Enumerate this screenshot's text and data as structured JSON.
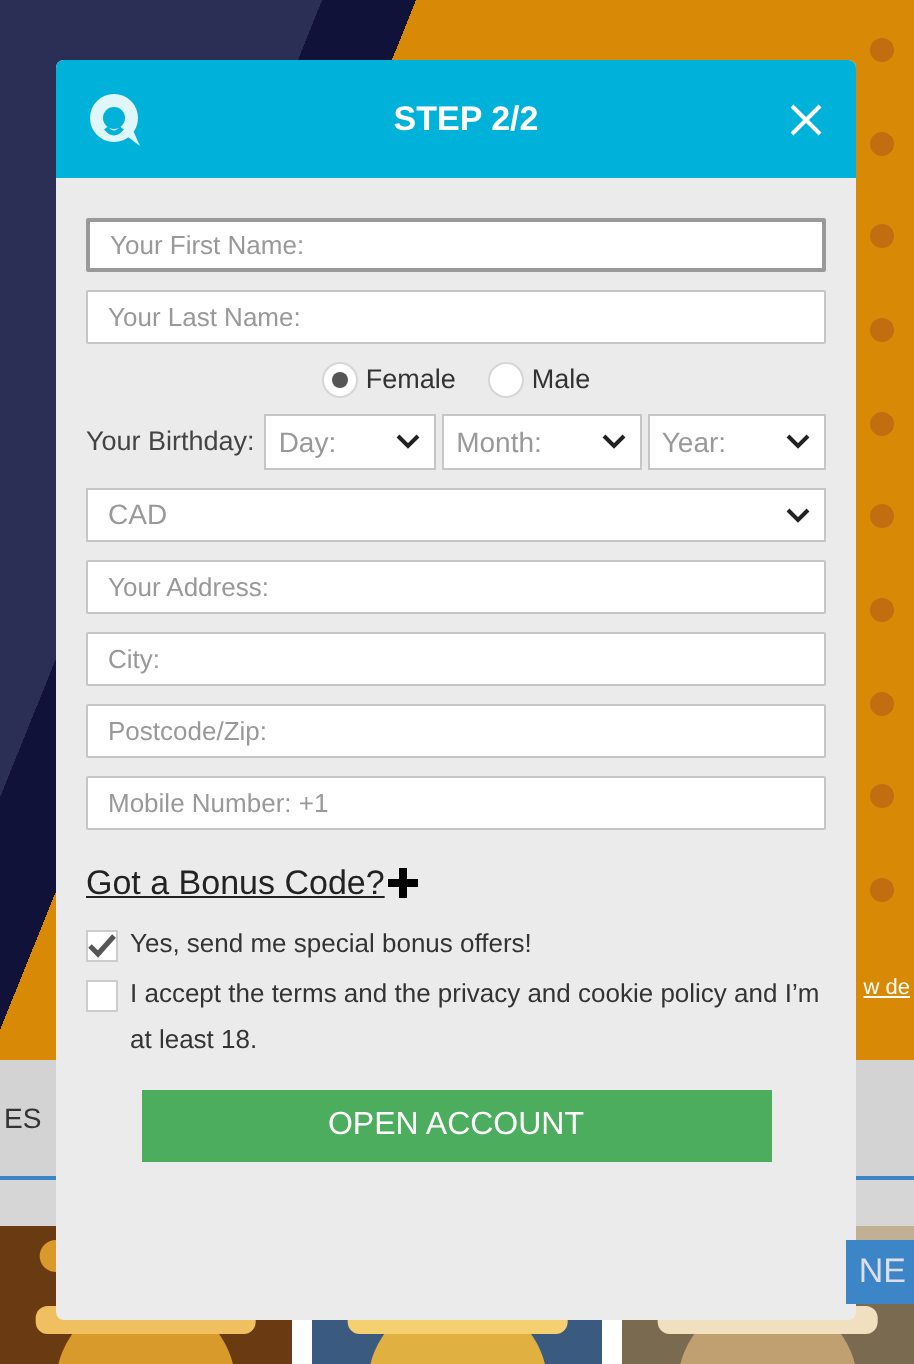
{
  "background": {
    "link": "w de",
    "nav_item": "ES",
    "badge": "NE"
  },
  "modal": {
    "title": "STEP 2/2",
    "rows": [
      {
        "kind": "text",
        "placeholder": "Your First Name:",
        "focused": true
      },
      {
        "kind": "text",
        "placeholder": "Your Last Name:",
        "focused": false
      },
      {
        "kind": "radio",
        "options": [
          {
            "label": "Female",
            "selected": true
          },
          {
            "label": "Male",
            "selected": false
          }
        ]
      },
      {
        "kind": "birthday",
        "label": "Your Birthday:",
        "selects": [
          {
            "placeholder": "Day:"
          },
          {
            "placeholder": "Month:"
          },
          {
            "placeholder": "Year:"
          }
        ]
      },
      {
        "kind": "select",
        "value": "CAD"
      },
      {
        "kind": "text",
        "placeholder": "Your Address:",
        "focused": false
      },
      {
        "kind": "text",
        "placeholder": "City:",
        "focused": false
      },
      {
        "kind": "text",
        "placeholder": "Postcode/Zip:",
        "focused": false
      },
      {
        "kind": "text",
        "placeholder": "Mobile Number: +1",
        "focused": false
      }
    ],
    "bonus_link": "Got a Bonus Code?",
    "checkboxes": [
      {
        "label": "Yes, send me special bonus offers!",
        "checked": true
      },
      {
        "label": "I accept the terms and the privacy and cookie policy and I’m at least 18.",
        "checked": false
      }
    ],
    "submit": "OPEN ACCOUNT"
  }
}
